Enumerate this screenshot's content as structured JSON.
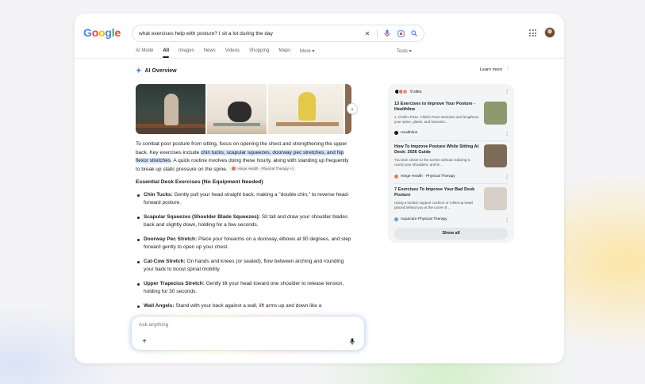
{
  "header": {
    "logo": [
      "G",
      "o",
      "o",
      "g",
      "l",
      "e"
    ],
    "logo_colors": [
      "#4285f4",
      "#ea4335",
      "#fbbc05",
      "#4285f4",
      "#34a853",
      "#ea4335"
    ],
    "query": "what exercises help with posture? I sit a lot during the day",
    "tabs": [
      "AI Mode",
      "All",
      "Images",
      "News",
      "Videos",
      "Shopping",
      "Maps",
      "More ▾"
    ],
    "active_tab": "All",
    "tools": "Tools ▾"
  },
  "overview": {
    "title": "AI Overview",
    "learn_more": "Learn more",
    "intro_before": "To combat poor posture from sitting, focus on opening the chest and strengthening the upper back. Key exercises include ",
    "intro_highlight": "chin tucks, scapular squeezes, doorway pec stretches, and hip flexor stretches",
    "intro_after": ". A quick routine involves doing these hourly, along with standing up frequently to break up static pressure on the spine.",
    "source_chip": "Hinge Health · Physical Therapy +1",
    "section_title": "Essential Desk Exercises (No Equipment Needed)",
    "exercises": [
      {
        "name": "Chin Tucks:",
        "text": " Gently pull your head straight back, making a \"double chin,\" to reverse head-forward posture."
      },
      {
        "name": "Scapular Squeezes (Shoulder Blade Squeezes):",
        "text": " Sit tall and draw your shoulder blades back and slightly down, holding for a few seconds."
      },
      {
        "name": "Doorway Pec Stretch:",
        "text": " Place your forearms on a doorway, elbows at 90 degrees, and step forward gently to open up your chest."
      },
      {
        "name": "Cat-Cow Stretch:",
        "text": " On hands and knees (or seated), flow between arching and rounding your back to boost spinal mobility."
      },
      {
        "name": "Upper Trapezius Stretch:",
        "text": " Gently tilt your head toward one shoulder to release tension, holding for 30 seconds."
      },
      {
        "name": "Wall Angels:",
        "text": " Stand with your back against a wall, lift arms up and down like a"
      }
    ]
  },
  "ask": {
    "placeholder": "Ask anything"
  },
  "sources": {
    "count_label": "9 sites",
    "favicon_colors": [
      "#111111",
      "#e07a5f",
      "#f28b82"
    ],
    "cards": [
      {
        "title": "13 Exercises to Improve Your Posture - Healthline",
        "snippet": "1. Child's Pose. Child's Pose stretches and lengthens your spine, glutes, and hamstrin...",
        "source": "Healthline",
        "color": "#1b1b1b",
        "thumb": "#8c9a6e"
      },
      {
        "title": "How To Improve Posture While Sitting At Desk: 2026 Guide",
        "snippet": "You lean closer to the screen without realizing it, round your shoulders, and le...",
        "source": "Hinge Health · Physical Therapy",
        "color": "#e07a5f",
        "thumb": "#7d6a58"
      },
      {
        "title": "7 Exercises To Improve Your Bad Desk Posture",
        "snippet": "Using a lumbar support cushion or rolled-up towel placed behind you at the curve of...",
        "source": "Aquacare Physical Therapy",
        "color": "#5aa6c8",
        "thumb": "#d8cfc6"
      }
    ],
    "show_all": "Show all"
  }
}
